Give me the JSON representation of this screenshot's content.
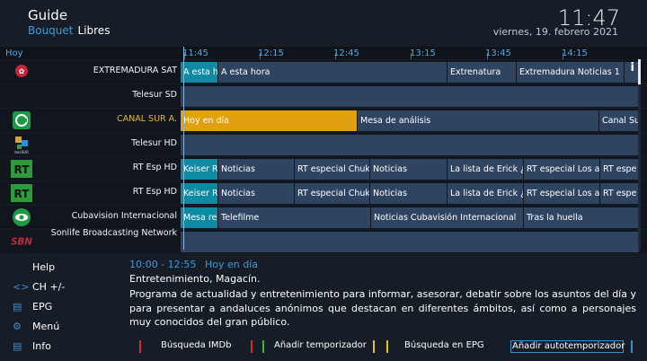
{
  "header": {
    "title": "Guide",
    "bouquet_label": "Bouquet",
    "bouquet_name": "Libres",
    "clock": "11:47",
    "date": "viernes, 19. febrero 2021"
  },
  "timebar": {
    "today": "Hoy",
    "times": [
      "11:45",
      "12:15",
      "12:45",
      "13:15",
      "13:45",
      "14:15"
    ]
  },
  "channels": [
    {
      "name": "EXTREMADURA SAT",
      "logo_icon": "canal-extremadura-logo",
      "selected": false,
      "events": [
        {
          "title": "A esta h",
          "now": true
        },
        {
          "title": "A esta hora"
        },
        {
          "title": "Extrenatura"
        },
        {
          "title": "Extremadura Noticias 1"
        }
      ]
    },
    {
      "name": "Telesur SD",
      "logo_icon": "",
      "selected": false,
      "events": []
    },
    {
      "name": "CANAL SUR A.",
      "logo_icon": "canal-sur-logo",
      "selected": true,
      "events": [
        {
          "title": "Hoy en día",
          "sel": true
        },
        {
          "title": "Mesa de análisis"
        },
        {
          "title": "Canal Su"
        }
      ]
    },
    {
      "name": "Telesur HD",
      "logo_icon": "telesur-logo",
      "selected": false,
      "events": []
    },
    {
      "name": "RT Esp HD",
      "logo_icon": "rt-logo",
      "selected": false,
      "events": [
        {
          "title": "Keiser R",
          "now": true
        },
        {
          "title": "Noticias"
        },
        {
          "title": "RT especial Chuko"
        },
        {
          "title": "Noticias"
        },
        {
          "title": "La lista de Erick ¿C"
        },
        {
          "title": "RT especial Los ar"
        },
        {
          "title": "RT espe"
        }
      ]
    },
    {
      "name": "RT Esp HD",
      "logo_icon": "rt-logo",
      "selected": false,
      "events": [
        {
          "title": "Keiser R",
          "now": true
        },
        {
          "title": "Noticias"
        },
        {
          "title": "RT especial Chuko"
        },
        {
          "title": "Noticias"
        },
        {
          "title": "La lista de Erick ¿C"
        },
        {
          "title": "RT especial Los ar"
        },
        {
          "title": "RT espe"
        }
      ]
    },
    {
      "name": "Cubavision Internacional",
      "logo_icon": "cubavision-logo",
      "selected": false,
      "events": [
        {
          "title": "Mesa re",
          "now": true
        },
        {
          "title": "Telefilme"
        },
        {
          "title": "Noticias Cubavisión Internacional"
        },
        {
          "title": "Tras la huella"
        }
      ]
    },
    {
      "name": "Sonlife Broadcasting Network",
      "logo_icon": "sbn-logo",
      "selected": false,
      "events": []
    }
  ],
  "menu": [
    {
      "label": "Help",
      "icon": ""
    },
    {
      "label": "CH +/-",
      "icon": "arrows-icon"
    },
    {
      "label": "EPG",
      "icon": "epg-icon"
    },
    {
      "label": "Menú",
      "icon": "gear-icon"
    },
    {
      "label": "Info",
      "icon": "info-icon"
    }
  ],
  "event_info": {
    "time": "10:00 - 12:55",
    "title": "Hoy en día",
    "genre": "Entretenimiento, Magacín.",
    "description": "Programa de actualidad y entretenimiento para informar, asesorar, debatir sobre los asuntos del día y para presentar a andaluces anónimos que destacan en diferentes ámbitos, así como a personajes muy conocidos del gran público."
  },
  "buttons": {
    "red": "Búsqueda IMDb",
    "green": "Añadir temporizador",
    "yellow": "Búsqueda en EPG",
    "blue": "Añadir autotemporizador"
  },
  "colors": {
    "red": "#d62a2a",
    "green": "#2fbf3a",
    "yellow": "#e8c21a",
    "blue": "#3a8fd1",
    "accent": "#3f9bd8",
    "selected_event": "#e1a00f",
    "now_event": "#0f8aa3"
  }
}
